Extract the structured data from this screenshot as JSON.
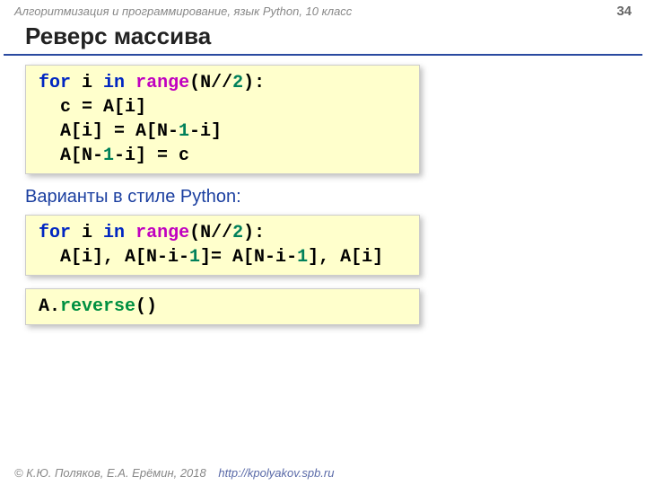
{
  "header": {
    "course": "Алгоритмизация и программирование, язык Python, 10 класс",
    "page": "34"
  },
  "title": "Реверс массива",
  "code1": {
    "l1a": "for",
    "l1b": " i ",
    "l1c": "in",
    "l1d": " ",
    "l1e": "range",
    "l1f": "(N//",
    "l1g": "2",
    "l1h": "):",
    "l2": "  с = A[i]",
    "l3a": "  A[i] = A[N-",
    "l3b": "1",
    "l3c": "-i]",
    "l4a": "  A[N-",
    "l4b": "1",
    "l4c": "-i] = с"
  },
  "subhead": "Варианты в стиле Python:",
  "code2": {
    "l1a": "for",
    "l1b": " i ",
    "l1c": "in",
    "l1d": " ",
    "l1e": "range",
    "l1f": "(N//",
    "l1g": "2",
    "l1h": "):",
    "l2a": "  A[i], A[N-i-",
    "l2b": "1",
    "l2c": "]= A[N-i-",
    "l2d": "1",
    "l2e": "], A[i]"
  },
  "code3": {
    "l1a": "A.",
    "l1b": "reverse",
    "l1c": "()"
  },
  "footer": {
    "copy": "© К.Ю. Поляков, Е.А. Ерёмин, 2018",
    "url": "http://kpolyakov.spb.ru"
  }
}
